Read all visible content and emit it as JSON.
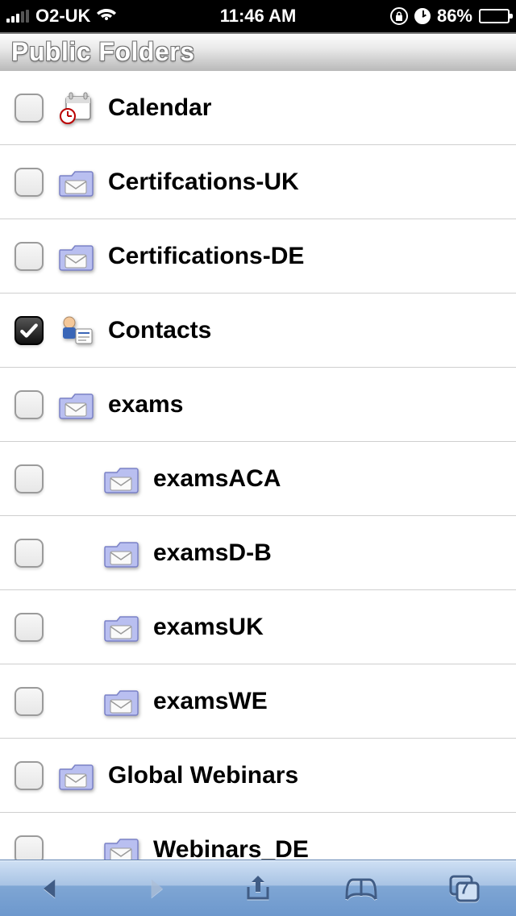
{
  "status": {
    "carrier": "O2-UK",
    "time": "11:46 AM",
    "battery_pct": "86%",
    "battery_fill_pct": 86
  },
  "header": {
    "title": "Public Folders"
  },
  "folders": [
    {
      "label": "Calendar",
      "checked": false,
      "icon": "calendar",
      "indent": false
    },
    {
      "label": "Certifcations-UK",
      "checked": false,
      "icon": "mailfolder",
      "indent": false
    },
    {
      "label": "Certifications-DE",
      "checked": false,
      "icon": "mailfolder",
      "indent": false
    },
    {
      "label": "Contacts",
      "checked": true,
      "icon": "contacts",
      "indent": false
    },
    {
      "label": "exams",
      "checked": false,
      "icon": "mailfolder",
      "indent": false
    },
    {
      "label": "examsACA",
      "checked": false,
      "icon": "mailfolder",
      "indent": true
    },
    {
      "label": "examsD-B",
      "checked": false,
      "icon": "mailfolder",
      "indent": true
    },
    {
      "label": "examsUK",
      "checked": false,
      "icon": "mailfolder",
      "indent": true
    },
    {
      "label": "examsWE",
      "checked": false,
      "icon": "mailfolder",
      "indent": true
    },
    {
      "label": "Global Webinars",
      "checked": false,
      "icon": "mailfolder",
      "indent": false
    },
    {
      "label": "Webinars_DE",
      "checked": false,
      "icon": "mailfolder",
      "indent": true
    }
  ],
  "toolbar": {
    "pages_count": "7"
  }
}
